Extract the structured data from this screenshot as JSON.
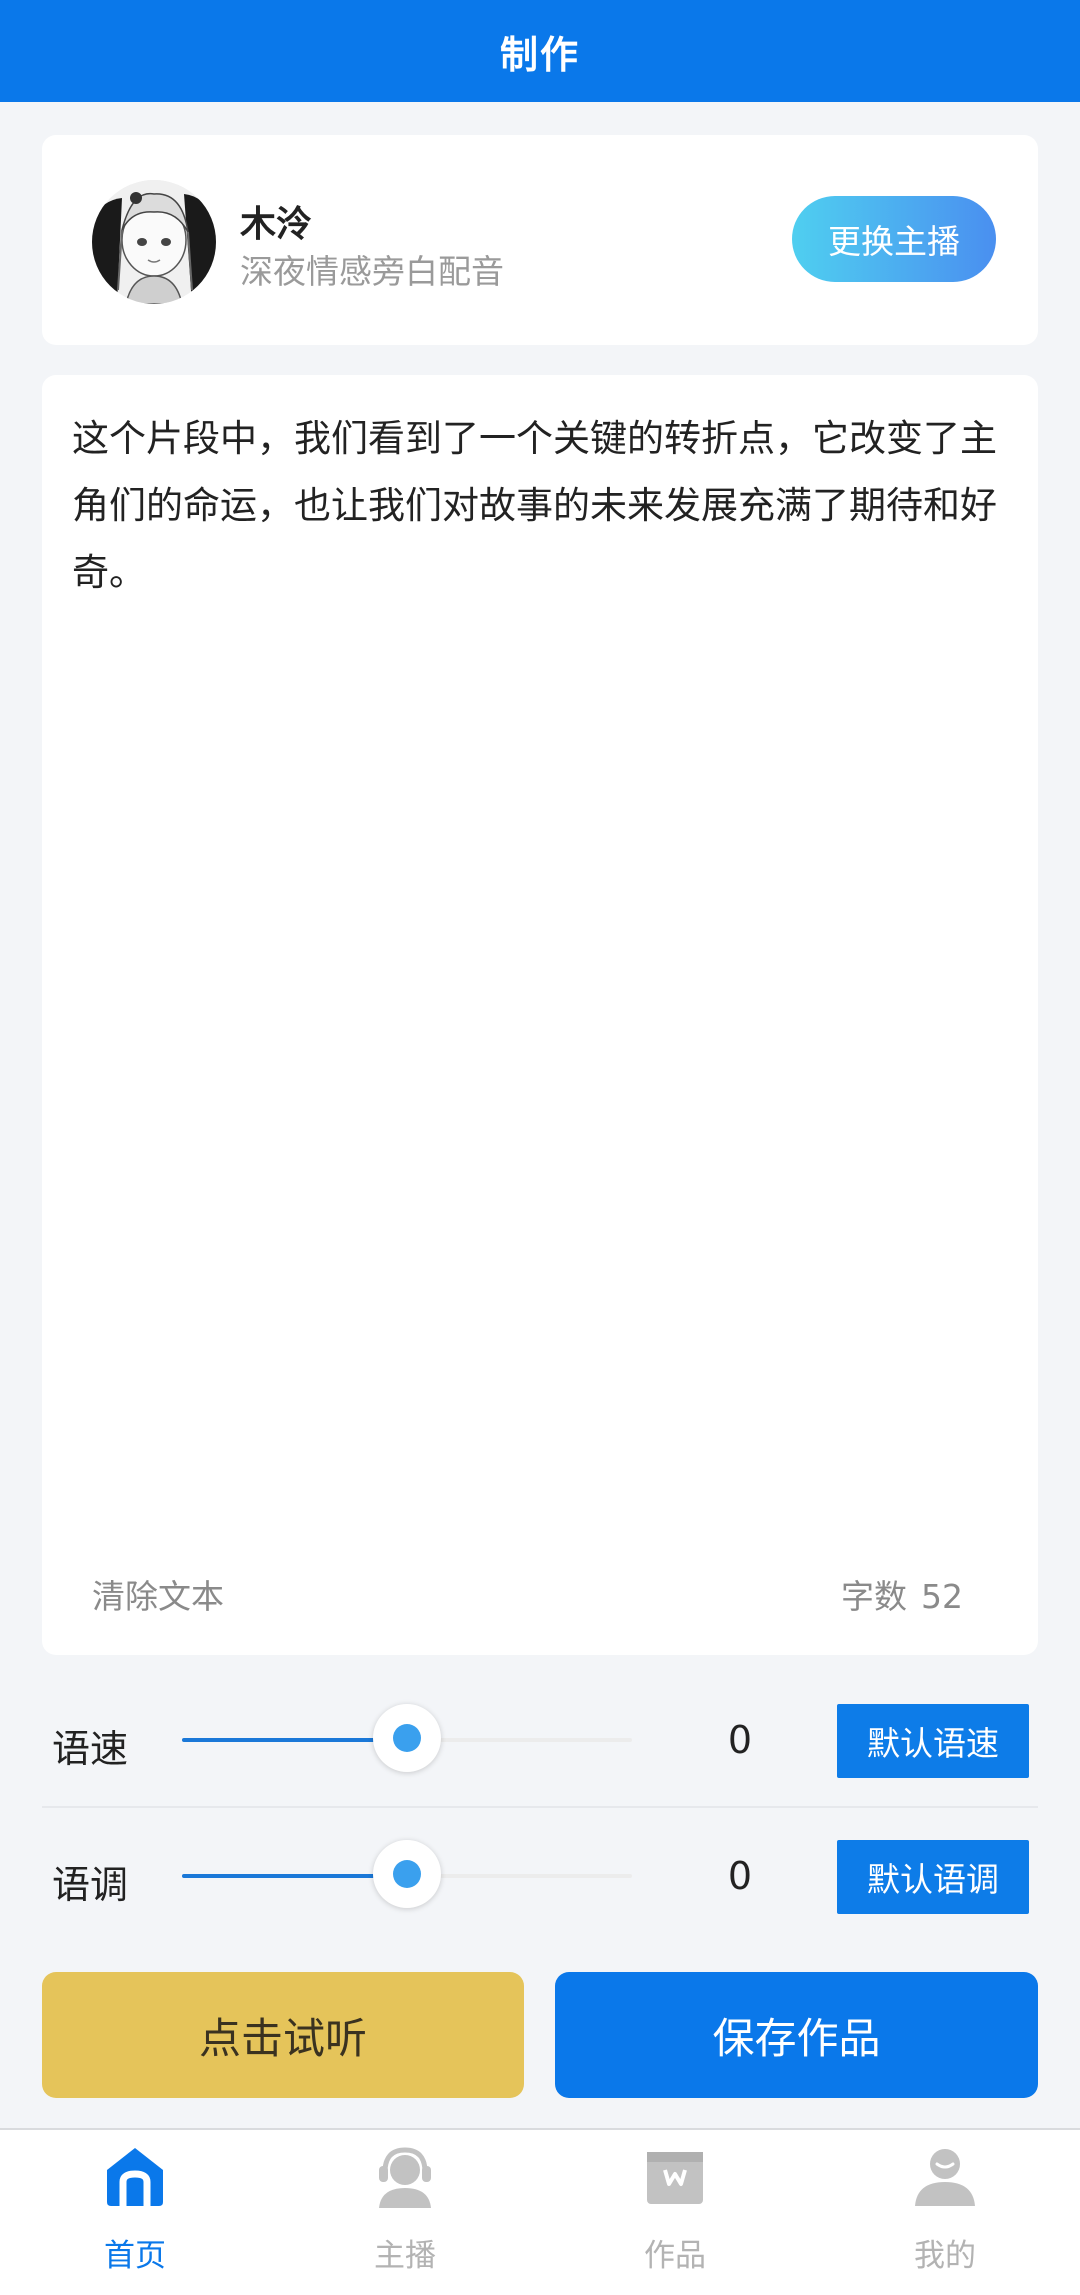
{
  "header": {
    "title": "制作"
  },
  "host": {
    "name": "木泠",
    "description": "深夜情感旁白配音",
    "change_button": "更换主播"
  },
  "editor": {
    "text": "这个片段中，我们看到了一个关键的转折点，它改变了主角们的命运，也让我们对故事的未来发展充满了期待和好奇。",
    "clear_label": "清除文本",
    "count_label": "字数",
    "count_value": "52"
  },
  "controls": {
    "speed": {
      "label": "语速",
      "value": "0",
      "level": 0.5,
      "default_button": "默认语速"
    },
    "pitch": {
      "label": "语调",
      "value": "0",
      "level": 0.5,
      "default_button": "默认语调"
    }
  },
  "actions": {
    "listen_label": "点击试听",
    "save_label": "保存作品"
  },
  "tabbar": {
    "items": [
      {
        "label": "首页",
        "icon": "home-icon",
        "active": true
      },
      {
        "label": "主播",
        "icon": "headset-avatar-icon",
        "active": false
      },
      {
        "label": "作品",
        "icon": "box-icon",
        "active": false
      },
      {
        "label": "我的",
        "icon": "user-icon",
        "active": false
      }
    ]
  },
  "colors": {
    "primary": "#0a78ea",
    "listen_button": "#e5c45a",
    "tab_inactive": "#b3b3b3"
  }
}
